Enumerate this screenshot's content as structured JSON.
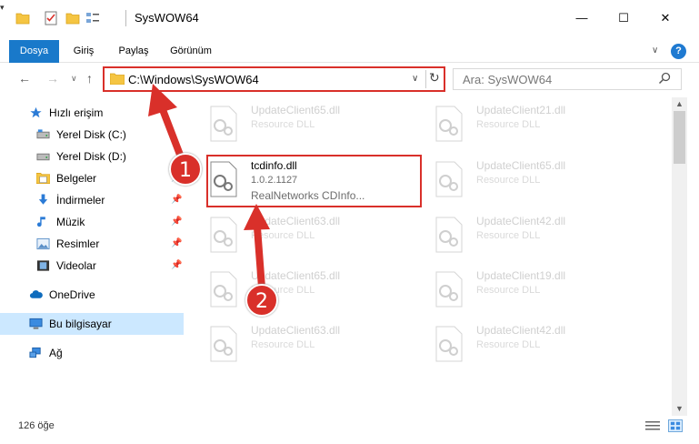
{
  "window": {
    "title": "SysWOW64",
    "minimize_label": "—",
    "maximize_label": "☐",
    "close_label": "✕"
  },
  "ribbon": {
    "tabs": [
      "Dosya",
      "Giriş",
      "Paylaş",
      "Görünüm"
    ],
    "help": "?"
  },
  "nav": {
    "address": "C:\\Windows\\SysWOW64",
    "search_placeholder": "Ara: SysWOW64"
  },
  "sidebar": {
    "items": [
      {
        "label": "Hızlı erişim",
        "icon": "star-icon"
      },
      {
        "label": "Yerel Disk (C:)",
        "icon": "drive-icon"
      },
      {
        "label": "Yerel Disk (D:)",
        "icon": "drive-icon"
      },
      {
        "label": "Belgeler",
        "icon": "documents-icon",
        "pinned": true
      },
      {
        "label": "İndirmeler",
        "icon": "download-icon",
        "pinned": true
      },
      {
        "label": "Müzik",
        "icon": "music-icon",
        "pinned": true
      },
      {
        "label": "Resimler",
        "icon": "pictures-icon",
        "pinned": true
      },
      {
        "label": "Videolar",
        "icon": "video-icon",
        "pinned": true
      },
      {
        "label": "OneDrive",
        "icon": "cloud-icon"
      },
      {
        "label": "Bu bilgisayar",
        "icon": "computer-icon",
        "selected": true
      },
      {
        "label": "Ağ",
        "icon": "network-icon"
      }
    ]
  },
  "files": [
    {
      "name": "UpdateClient65.dll",
      "desc": "Resource DLL"
    },
    {
      "name": "UpdateClient21.dll",
      "desc": "Resource DLL"
    },
    {
      "name": "tcdinfo.dll",
      "desc": "1.0.2.1127",
      "desc2": "RealNetworks CDInfo..."
    },
    {
      "name": "UpdateClient65.dll",
      "desc": "Resource DLL"
    },
    {
      "name": "UpdateClient63.dll",
      "desc": "Resource DLL"
    },
    {
      "name": "UpdateClient42.dll",
      "desc": "Resource DLL"
    },
    {
      "name": "UpdateClient65.dll",
      "desc": "Resource DLL"
    },
    {
      "name": "UpdateClient19.dll",
      "desc": "Resource DLL"
    },
    {
      "name": "UpdateClient63.dll",
      "desc": "Resource DLL"
    },
    {
      "name": "UpdateClient42.dll",
      "desc": "Resource DLL"
    }
  ],
  "status": {
    "item_count": "126 öğe"
  },
  "annotations": {
    "badge_1": "1",
    "badge_2": "2"
  },
  "colors": {
    "accent": "#1979ca",
    "highlight_red": "#d9302a",
    "selection": "#cce8ff"
  }
}
